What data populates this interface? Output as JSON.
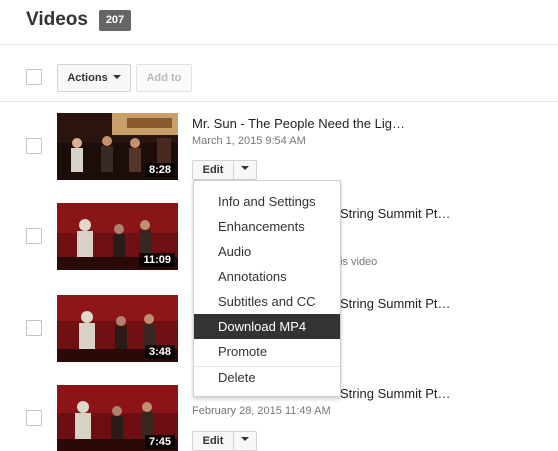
{
  "header": {
    "title": "Videos",
    "count": "207"
  },
  "toolbar": {
    "actions_label": "Actions",
    "add_to_label": "Add to"
  },
  "videos": [
    {
      "title": "Mr. Sun - The People Need the Lig…",
      "date": "March 1, 2015 9:54 AM",
      "duration": "8:28",
      "edit_label": "Edit",
      "note": ""
    },
    {
      "title": "String Summit Pt…",
      "date": "",
      "duration": "11:09",
      "edit_label": "",
      "note": "is video"
    },
    {
      "title": "String Summit Pt…",
      "date": "",
      "duration": "3:48",
      "edit_label": "",
      "note": ""
    },
    {
      "title": "String Summit Pt…",
      "date": "February 28, 2015 11:49 AM",
      "duration": "7:45",
      "edit_label": "Edit",
      "note": ""
    }
  ],
  "edit_menu": {
    "items": [
      "Info and Settings",
      "Enhancements",
      "Audio",
      "Annotations",
      "Subtitles and CC",
      "Download MP4",
      "Promote"
    ],
    "active_item": "Download MP4",
    "delete_label": "Delete"
  },
  "colors": {
    "badge": "#666666",
    "menu_active_bg": "#333333",
    "date_text": "#767676"
  }
}
